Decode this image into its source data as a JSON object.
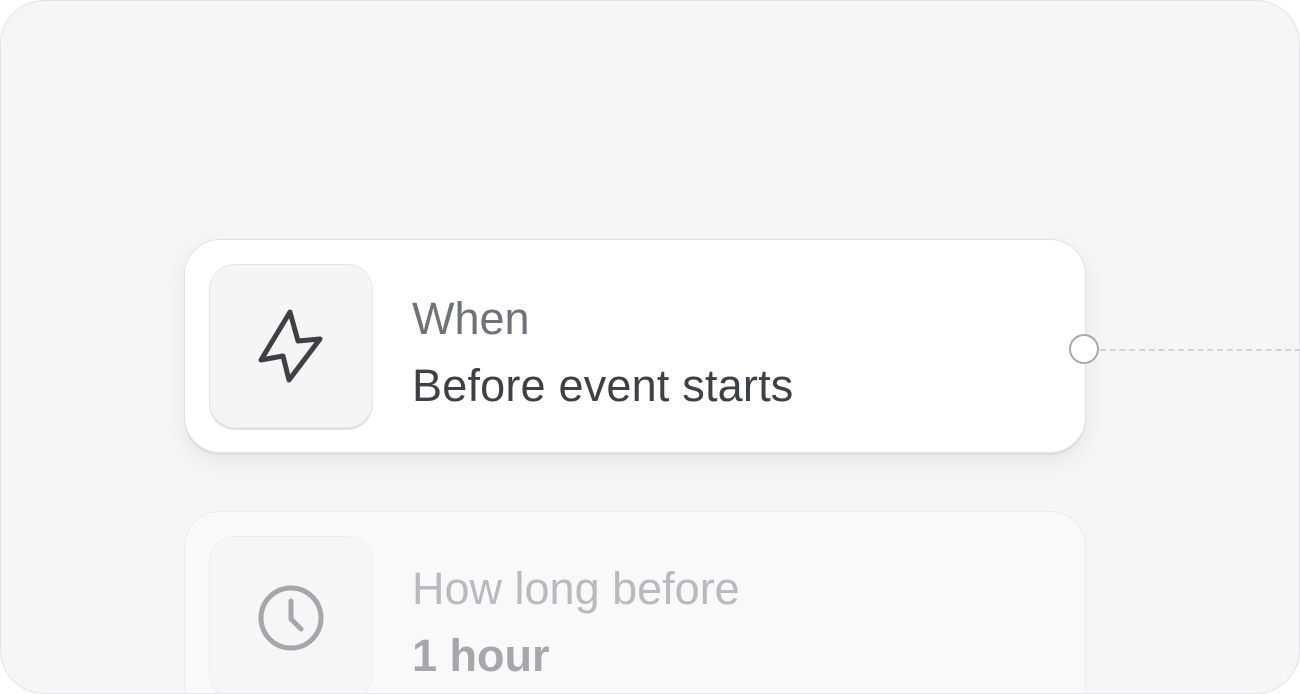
{
  "trigger_card": {
    "label": "When",
    "value": "Before event starts",
    "icon": "lightning-icon"
  },
  "offset_card": {
    "label": "How long before",
    "value": "1 hour",
    "icon": "clock-icon"
  },
  "colors": {
    "canvas_bg": "#f6f6f6",
    "card_bg": "#ffffff",
    "label_text": "#71717a",
    "value_text": "#3f3f46",
    "muted_label": "#b9b9bf",
    "muted_value": "#a6a6ac"
  }
}
